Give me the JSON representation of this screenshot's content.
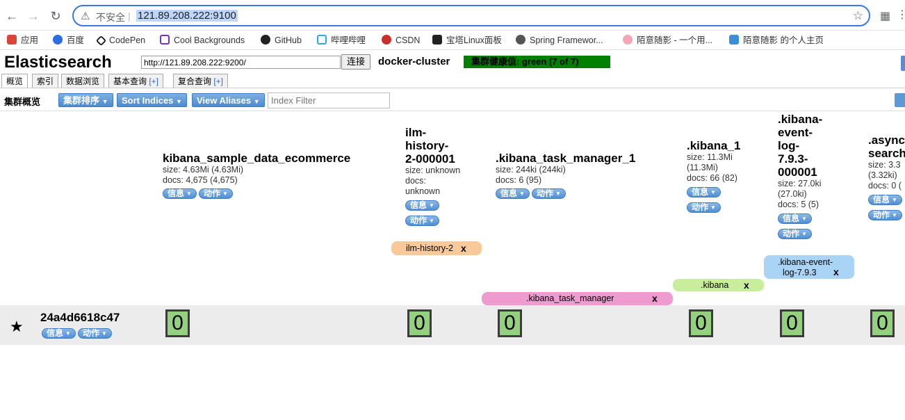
{
  "browser": {
    "insecure_label": "不安全",
    "separator": "|",
    "url": "121.89.208.222:9100"
  },
  "bookmarks": [
    {
      "label": "应用",
      "color": "#db4437"
    },
    {
      "label": "百度",
      "color": "#2b6de5"
    },
    {
      "label": "CodePen",
      "color": "#222222"
    },
    {
      "label": "Cool Backgrounds",
      "color": "#7b2fbe"
    },
    {
      "label": "GitHub",
      "color": "#222222"
    },
    {
      "label": "哔哩哔哩",
      "color": "#23ade5"
    },
    {
      "label": "CSDN",
      "color": "#c9302c"
    },
    {
      "label": "宝塔Linux面板",
      "color": "#222222"
    },
    {
      "label": "Spring Framewor...",
      "color": "#555555"
    },
    {
      "label": "陌意随影 - 一个用...",
      "color": "#f4a6b8"
    },
    {
      "label": "陌意随影 的个人主页",
      "color": "#3a8fd6"
    }
  ],
  "es": {
    "title": "Elasticsearch",
    "url_value": "http://121.89.208.222:9200/",
    "connect_label": "连接",
    "cluster_name": "docker-cluster",
    "health": "集群健康值: green (7 of 7)",
    "tabs": [
      {
        "label": "概览",
        "plus": ""
      },
      {
        "label": "索引",
        "plus": ""
      },
      {
        "label": "数据浏览",
        "plus": ""
      },
      {
        "label": "基本查询 ",
        "plus": "[+]"
      },
      {
        "label": "复合查询 ",
        "plus": "[+]"
      }
    ]
  },
  "toolbar": {
    "title": "集群概览",
    "cluster_sort": "集群排序",
    "sort_indices": "Sort Indices",
    "view_aliases": "View Aliases",
    "filter_placeholder": "Index Filter"
  },
  "pill_labels": {
    "info": "信息",
    "action": "动作"
  },
  "indices": [
    {
      "name": "kibana_sample_data_ecommerce",
      "size": "size: 4.63Mi (4.63Mi)",
      "docs": "docs: 4,675 (4,675)"
    },
    {
      "name": "ilm-history-2-000001",
      "size": "size: unknown",
      "docs": "docs: unknown"
    },
    {
      "name": ".kibana_task_manager_1",
      "size": "size: 244ki (244ki)",
      "docs": "docs: 6 (95)"
    },
    {
      "name": ".kibana_1",
      "size": "size: 11.3Mi (11.3Mi)",
      "docs": "docs: 66 (82)"
    },
    {
      "name": ".kibana-event-log-7.9.3-000001",
      "size": "size: 27.0ki (27.0ki)",
      "docs": "docs: 5 (5)"
    },
    {
      "name": ".async-search",
      "size": "size: 3.3",
      "docs": "docs: 0 ("
    }
  ],
  "aliases": [
    {
      "label": "ilm-history-2",
      "color": "#f9c99a"
    },
    {
      "label": ".kibana-event-log-7.9.3",
      "color": "#a9d4f5"
    },
    {
      "label": ".kibana",
      "color": "#c9ee9b"
    },
    {
      "label": ".kibana_task_manager",
      "color": "#ee9ccf"
    }
  ],
  "alias_close": "x",
  "node": {
    "name": "24a4d6618c47",
    "shards": [
      "0",
      "0",
      "0",
      "0",
      "0",
      "0"
    ]
  }
}
